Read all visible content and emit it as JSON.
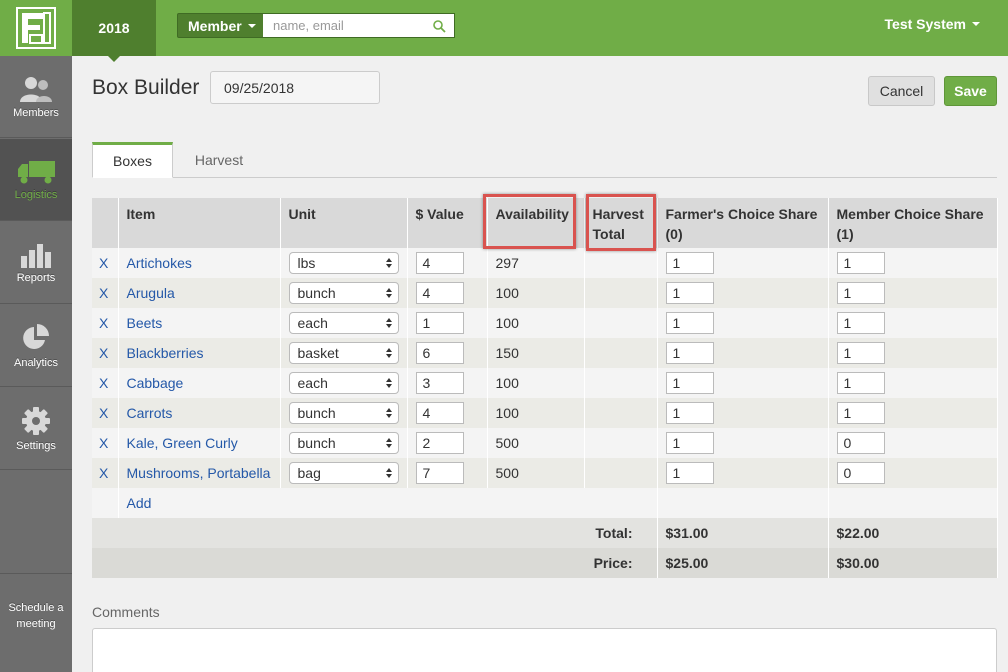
{
  "topbar": {
    "year": "2018",
    "member_label": "Member",
    "search_placeholder": "name, email",
    "user": "Test System"
  },
  "sidebar": {
    "items": [
      {
        "label": "Members",
        "icon": "members-icon"
      },
      {
        "label": "Logistics",
        "icon": "truck-icon",
        "active": true
      },
      {
        "label": "Reports",
        "icon": "bar-chart-icon"
      },
      {
        "label": "Analytics",
        "icon": "pie-chart-icon"
      },
      {
        "label": "Settings",
        "icon": "gear-icon"
      }
    ],
    "schedule_line1": "Schedule a",
    "schedule_line2": "meeting"
  },
  "header": {
    "title": "Box Builder",
    "date": "09/25/2018",
    "cancel_label": "Cancel",
    "save_label": "Save"
  },
  "tabs": [
    "Boxes",
    "Harvest"
  ],
  "table": {
    "headers": {
      "item": "Item",
      "unit": "Unit",
      "value": "$ Value",
      "availability": "Availability",
      "harvest_total_1": "Harvest",
      "harvest_total_2": "Total",
      "farmers_choice_1": "Farmer's Choice Share",
      "farmers_choice_2": "(0)",
      "member_choice_1": "Member Choice Share",
      "member_choice_2": "(1)"
    },
    "remove_label": "X",
    "rows": [
      {
        "item": "Artichokes",
        "unit": "lbs",
        "value": "4",
        "availability": "297",
        "farmers": "1",
        "member": "1"
      },
      {
        "item": "Arugula",
        "unit": "bunch",
        "value": "4",
        "availability": "100",
        "farmers": "1",
        "member": "1"
      },
      {
        "item": "Beets",
        "unit": "each",
        "value": "1",
        "availability": "100",
        "farmers": "1",
        "member": "1"
      },
      {
        "item": "Blackberries",
        "unit": "basket",
        "value": "6",
        "availability": "150",
        "farmers": "1",
        "member": "1"
      },
      {
        "item": "Cabbage",
        "unit": "each",
        "value": "3",
        "availability": "100",
        "farmers": "1",
        "member": "1"
      },
      {
        "item": "Carrots",
        "unit": "bunch",
        "value": "4",
        "availability": "100",
        "farmers": "1",
        "member": "1"
      },
      {
        "item": "Kale, Green Curly",
        "unit": "bunch",
        "value": "2",
        "availability": "500",
        "farmers": "1",
        "member": "0"
      },
      {
        "item": "Mushrooms, Portabella",
        "unit": "bag",
        "value": "7",
        "availability": "500",
        "farmers": "1",
        "member": "0"
      }
    ],
    "add_label": "Add",
    "total_label": "Total:",
    "total_farmers": "$31.00",
    "total_member": "$22.00",
    "price_label": "Price:",
    "price_farmers": "$25.00",
    "price_member": "$30.00"
  },
  "comments_label": "Comments",
  "colors": {
    "brand_green": "#70ad47",
    "dark_green": "#4f7f2e",
    "highlight_red": "#d9534f",
    "link_blue": "#2458a8"
  }
}
